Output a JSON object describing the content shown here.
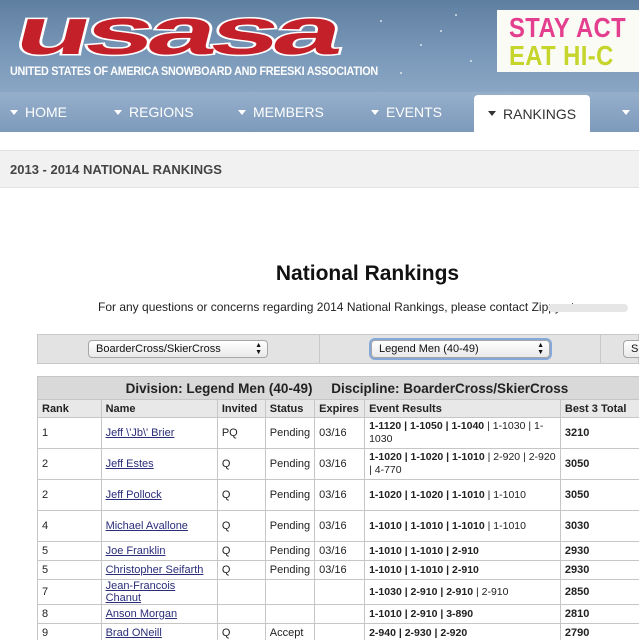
{
  "header": {
    "logo_text": "usasa",
    "tagline": "UNITED STATES OF AMERICA SNOWBOARD AND FREESKI ASSOCIATION",
    "ad_line1": "STAY ACT",
    "ad_line2": "EAT HI-C"
  },
  "nav": {
    "items": [
      "HOME",
      "REGIONS",
      "MEMBERS",
      "EVENTS",
      "RANKINGS"
    ],
    "active": "RANKINGS"
  },
  "breadcrumb": "2013 - 2014 NATIONAL RANKINGS",
  "page": {
    "title": "National Rankings",
    "contact": "For any questions or concerns regarding 2014 National Rankings, please contact Zippy at"
  },
  "selectors": {
    "discipline": "BoarderCross/SkierCross",
    "division": "Legend Men (40-49)",
    "third": "Se"
  },
  "table": {
    "caption_division": "Division: Legend Men (40-49)",
    "caption_discipline": "Discipline: BoarderCross/SkierCross",
    "headers": [
      "Rank",
      "Name",
      "Invited",
      "Status",
      "Expires",
      "Event Results",
      "Best 3 Total"
    ],
    "rows": [
      {
        "rank": "1",
        "name": "Jeff \\'Jb\\' Brier",
        "invited": "PQ",
        "status": "Pending",
        "expires": "03/16",
        "results": "1-1120 | 1-1050 | 1-1040",
        "results_extra": " | 1-1030 | 1-1030",
        "total": "3210"
      },
      {
        "rank": "2",
        "name": "Jeff Estes",
        "invited": "Q",
        "status": "Pending",
        "expires": "03/16",
        "results": "1-1020 | 1-1020 | 1-1010",
        "results_extra": " | 2-920 | 2-920 | 4-770",
        "total": "3050"
      },
      {
        "rank": "2",
        "name": "Jeff Pollock",
        "invited": "Q",
        "status": "Pending",
        "expires": "03/16",
        "results": "1-1020 | 1-1020 | 1-1010",
        "results_extra": " | 1-1010",
        "total": "3050"
      },
      {
        "rank": "4",
        "name": "Michael Avallone",
        "invited": "Q",
        "status": "Pending",
        "expires": "03/16",
        "results": "1-1010 | 1-1010 | 1-1010",
        "results_extra": " | 1-1010",
        "total": "3030"
      },
      {
        "rank": "5",
        "name": "Joe Franklin",
        "invited": "Q",
        "status": "Pending",
        "expires": "03/16",
        "results": "1-1010 | 1-1010 | 2-910",
        "results_extra": "",
        "total": "2930"
      },
      {
        "rank": "5",
        "name": "Christopher Seifarth",
        "invited": "Q",
        "status": "Pending",
        "expires": "03/16",
        "results": "1-1010 | 1-1010 | 2-910",
        "results_extra": "",
        "total": "2930"
      },
      {
        "rank": "7",
        "name": "Jean-Francois Chanut",
        "invited": "",
        "status": "",
        "expires": "",
        "results": "1-1030 | 2-910 | 2-910",
        "results_extra": " | 2-910",
        "total": "2850"
      },
      {
        "rank": "8",
        "name": "Anson Morgan",
        "invited": "",
        "status": "",
        "expires": "",
        "results": "1-1010 | 2-910 | 3-890",
        "results_extra": "",
        "total": "2810"
      },
      {
        "rank": "9",
        "name": "Brad ONeill",
        "invited": "Q",
        "status": "Accept",
        "expires": "",
        "results": "2-940 | 2-930 | 2-920",
        "results_extra": "",
        "total": "2790"
      }
    ]
  }
}
